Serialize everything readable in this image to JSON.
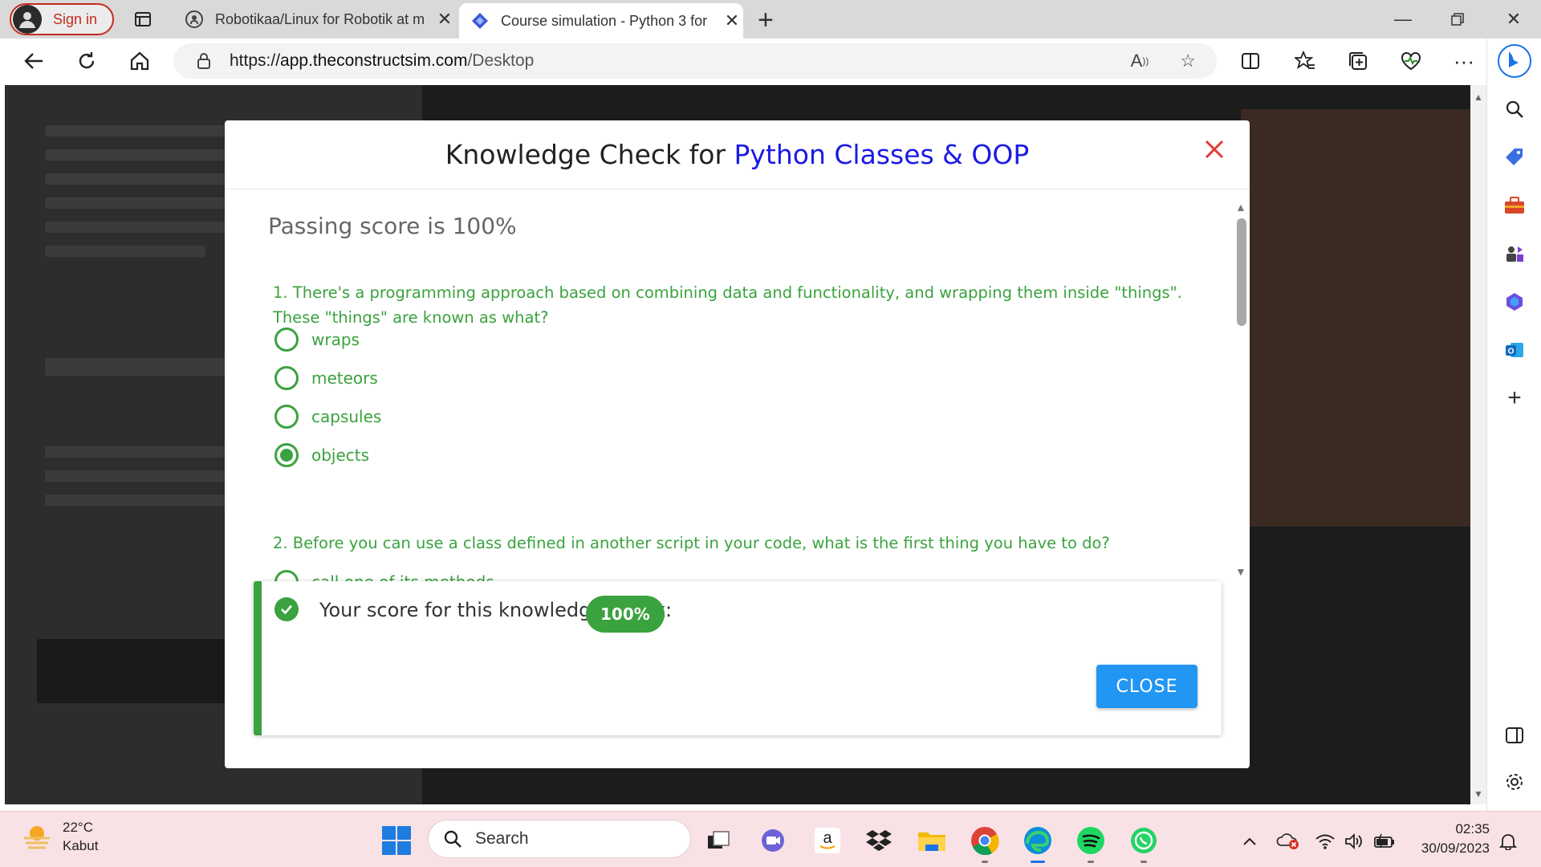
{
  "browser": {
    "profile_label": "Sign in",
    "tabs": [
      {
        "title": "Robotikaa/Linux for Robotik at m",
        "icon": "github-icon",
        "active": false
      },
      {
        "title": "Course simulation - Python 3 for",
        "icon": "theconstruct-icon",
        "active": true
      }
    ],
    "url_scheme": "https://",
    "url_host": "app.theconstructsim.com",
    "url_path": "/Desktop"
  },
  "modal": {
    "title_prefix": "Knowledge Check for ",
    "title_topic": "Python Classes & OOP",
    "passing_score": "Passing score is 100%",
    "questions": [
      {
        "text": "1. There's a programming approach based on combining data and functionality, and wrapping them inside \"things\". These \"things\" are known as what?",
        "options": [
          "wraps",
          "meteors",
          "capsules",
          "objects"
        ],
        "selected_index": 3
      },
      {
        "text": "2. Before you can use a class defined in another script in your code, what is the first thing you have to do?",
        "options": [
          "call one of its methods"
        ],
        "selected_index": null
      }
    ],
    "result_text": "Your score for this knowledge check:",
    "score_badge": "100%",
    "close_label": "CLOSE"
  },
  "taskbar": {
    "weather_temp": "22°C",
    "weather_desc": "Kabut",
    "search_label": "Search",
    "time": "02:35",
    "date": "30/09/2023"
  },
  "colors": {
    "accent_green": "#3aa23e",
    "title_blue": "#1a1ae6",
    "close_button_blue": "#2196f3",
    "close_x_red": "#e53935"
  }
}
